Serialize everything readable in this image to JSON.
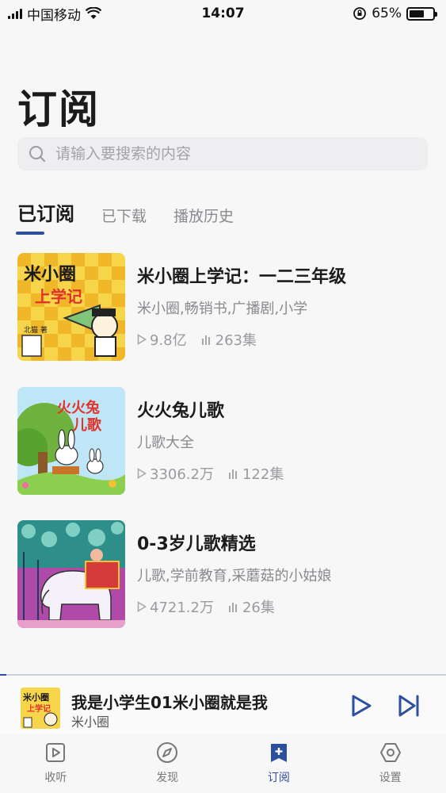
{
  "status_bar": {
    "carrier": "中国移动",
    "time": "14:07",
    "battery": "65%",
    "battery_level": 0.65
  },
  "page": {
    "title": "订阅"
  },
  "search": {
    "placeholder": "请输入要搜索的内容"
  },
  "tabs": [
    {
      "label": "已订阅",
      "active": true
    },
    {
      "label": "已下载",
      "active": false
    },
    {
      "label": "播放历史",
      "active": false
    }
  ],
  "subscriptions": [
    {
      "title": "米小圈上学记：一二三年级",
      "tags": "米小圈,畅销书,广播剧,小学",
      "plays": "9.8亿",
      "episodes": "263集",
      "cover_text": "米小圈 上学记",
      "cover_author": "北猫 著"
    },
    {
      "title": "火火兔儿歌",
      "tags": "儿歌大全",
      "plays": "3306.2万",
      "episodes": "122集",
      "cover_text": "火火兔 儿歌"
    },
    {
      "title": "0-3岁儿歌精选",
      "tags": "儿歌,学前教育,采蘑菇的小姑娘",
      "plays": "4721.2万",
      "episodes": "26集"
    }
  ],
  "player": {
    "title": "我是小学生01米小圈就是我",
    "subtitle": "米小圈"
  },
  "tabbar": [
    {
      "label": "收听",
      "icon": "play-square-icon",
      "active": false
    },
    {
      "label": "发现",
      "icon": "compass-icon",
      "active": false
    },
    {
      "label": "订阅",
      "icon": "subscribe-plus-icon",
      "active": true
    },
    {
      "label": "设置",
      "icon": "settings-hexagon-icon",
      "active": false
    }
  ],
  "colors": {
    "accent": "#2c4f9e",
    "background": "#f7f7f8",
    "muted_text": "#8a8a8f"
  }
}
